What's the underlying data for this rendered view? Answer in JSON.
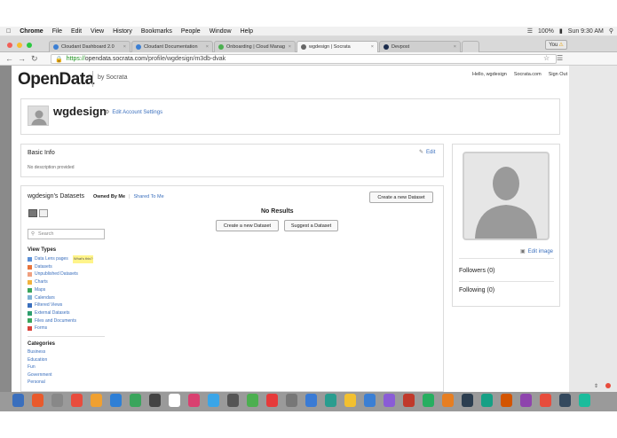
{
  "menubar": {
    "items": [
      "Chrome",
      "File",
      "Edit",
      "View",
      "History",
      "Bookmarks",
      "People",
      "Window",
      "Help"
    ],
    "battery": "100%",
    "clock": "Sun 9:30 AM"
  },
  "browser": {
    "tabs": [
      {
        "label": "Cloudant Dashboard 2.0",
        "color": "#3b7fd4"
      },
      {
        "label": "Cloudant Documentation",
        "color": "#3b7fd4"
      },
      {
        "label": "Onboarding | Cloud Manag",
        "color": "#4caf50"
      },
      {
        "label": "wgdesign | Socrata",
        "color": "#666666"
      },
      {
        "label": "Devpost",
        "color": "#1a2b4c"
      }
    ],
    "user_badge": "You",
    "url_scheme": "https://",
    "url_host": "opendata.socrata.com",
    "url_path": "/profile/wgdesign/m3db-dvak"
  },
  "site": {
    "logo": "OpenData",
    "by": "by Socrata",
    "links": [
      "Hello, wgdesign",
      "Socrata.com",
      "Sign Out"
    ]
  },
  "profile": {
    "name": "wgdesign",
    "edit_account": "Edit Account Settings"
  },
  "basic_info": {
    "title": "Basic Info",
    "edit": "Edit",
    "description": "No description provided"
  },
  "datasets": {
    "title": "wgdesign's Datasets",
    "tab_owned": "Owned By Me",
    "tab_shared": "Shared To Me",
    "create_button": "Create a new Dataset",
    "no_results": "No Results",
    "create_button2": "Create a new Dataset",
    "suggest_button": "Suggest a Dataset",
    "search_placeholder": "Search",
    "view_types_title": "View Types",
    "view_types": [
      {
        "label": "Data Lens pages",
        "color": "#5b8fd6"
      },
      {
        "label": "Datasets",
        "color": "#e8743b"
      },
      {
        "label": "Unpublished Datasets",
        "color": "#f0a080"
      },
      {
        "label": "Charts",
        "color": "#f2b33d"
      },
      {
        "label": "Maps",
        "color": "#3aa55c"
      },
      {
        "label": "Calendars",
        "color": "#7fb3d5"
      },
      {
        "label": "Filtered Views",
        "color": "#3a6fbd"
      },
      {
        "label": "External Datasets",
        "color": "#2e9e6e"
      },
      {
        "label": "Files and Documents",
        "color": "#3aa55c"
      },
      {
        "label": "Forms",
        "color": "#d9443b"
      }
    ],
    "whats_this": "What's this?",
    "categories_title": "Categories",
    "categories": [
      "Business",
      "Education",
      "Fun",
      "Government",
      "Personal"
    ]
  },
  "side": {
    "edit_image": "Edit image",
    "followers": "Followers (0)",
    "following": "Following (0)"
  },
  "dock_colors": [
    "#3a6fbd",
    "#e85a2c",
    "#888",
    "#e84c3d",
    "#f0a030",
    "#2e7fd6",
    "#3aa55c",
    "#444",
    "#fff",
    "#d94070",
    "#3aa5e8",
    "#555",
    "#4caf50",
    "#e63b3b",
    "#777",
    "#3a7bd5",
    "#2a9d8f",
    "#f2c030",
    "#3b7fd4",
    "#8a5cd6",
    "#c0392b",
    "#27ae60",
    "#e67e22",
    "#2c3e50",
    "#16a085",
    "#d35400",
    "#8e44ad",
    "#e74c3c",
    "#34495e",
    "#1abc9c"
  ]
}
